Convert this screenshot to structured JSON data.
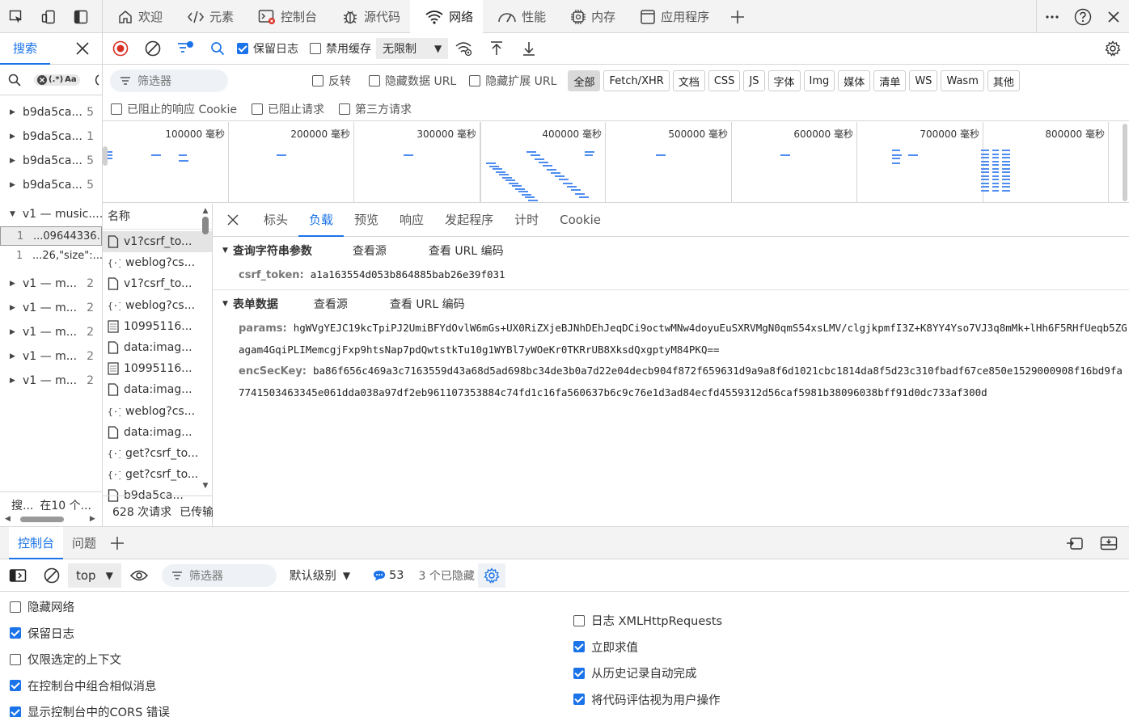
{
  "topbar": {
    "tabs": [
      {
        "label": "欢迎",
        "icon": "home-icon"
      },
      {
        "label": "元素",
        "icon": "code-icon"
      },
      {
        "label": "控制台",
        "icon": "console-icon"
      },
      {
        "label": "源代码",
        "icon": "bug-icon"
      },
      {
        "label": "网络",
        "icon": "wifi-icon"
      },
      {
        "label": "性能",
        "icon": "gauge-icon"
      },
      {
        "label": "内存",
        "icon": "chip-icon"
      },
      {
        "label": "应用程序",
        "icon": "app-icon"
      }
    ]
  },
  "search": {
    "title": "搜索",
    "regex_label": "(.*)",
    "case_label": "Aa",
    "results": [
      {
        "name": "b9da5ca...",
        "count": "5"
      },
      {
        "name": "b9da5ca...",
        "count": "1"
      },
      {
        "name": "b9da5ca...",
        "count": "5"
      },
      {
        "name": "b9da5ca...",
        "count": "5"
      }
    ],
    "expanded": {
      "name": "v1 — music....",
      "lines": [
        {
          "ln": "1",
          "text": "...09644336..."
        },
        {
          "ln": "1",
          "text": "...26,\"size\":..."
        }
      ]
    },
    "more": [
      {
        "name": "v1 — m...",
        "count": "2"
      },
      {
        "name": "v1 — m...",
        "count": "2"
      },
      {
        "name": "v1 — m...",
        "count": "2"
      },
      {
        "name": "v1 — m...",
        "count": "2"
      },
      {
        "name": "v1 — m...",
        "count": "2"
      }
    ],
    "footer": {
      "left": "搜...",
      "right": "在10 个..."
    }
  },
  "toolbar": {
    "preserve_log": "保留日志",
    "disable_cache": "禁用缓存",
    "throttle": "无限制"
  },
  "filter": {
    "placeholder": "筛选器",
    "invert": "反转",
    "hide_data_url": "隐藏数据 URL",
    "hide_ext_url": "隐藏扩展 URL",
    "types": [
      "全部",
      "Fetch/XHR",
      "文档",
      "CSS",
      "JS",
      "字体",
      "Img",
      "媒体",
      "清单",
      "WS",
      "Wasm",
      "其他"
    ],
    "blocked_cookies": "已阻止的响应 Cookie",
    "blocked_requests": "已阻止请求",
    "third_party": "第三方请求"
  },
  "overview": {
    "ticks": [
      "100000 毫秒",
      "200000 毫秒",
      "300000 毫秒",
      "400000 毫秒",
      "500000 毫秒",
      "600000 毫秒",
      "700000 毫秒",
      "800000 毫秒"
    ]
  },
  "requests": {
    "header": "名称",
    "rows": [
      {
        "name": "v1?csrf_to...",
        "icon": "doc-icon"
      },
      {
        "name": "weblog?cs...",
        "icon": "xhr-icon"
      },
      {
        "name": "v1?csrf_to...",
        "icon": "doc-icon"
      },
      {
        "name": "weblog?cs...",
        "icon": "xhr-icon"
      },
      {
        "name": "10995116...",
        "icon": "img-icon"
      },
      {
        "name": "data:imag...",
        "icon": "doc-icon"
      },
      {
        "name": "10995116...",
        "icon": "img-icon"
      },
      {
        "name": "data:imag...",
        "icon": "doc-icon"
      },
      {
        "name": "weblog?cs...",
        "icon": "xhr-icon"
      },
      {
        "name": "data:imag...",
        "icon": "doc-icon"
      },
      {
        "name": "get?csrf_to...",
        "icon": "xhr-icon"
      },
      {
        "name": "get?csrf_to...",
        "icon": "xhr-icon"
      },
      {
        "name": "b9da5ca...",
        "icon": "doc-icon"
      }
    ],
    "footer_count": "628 次请求",
    "footer_transfer": "已传输"
  },
  "detail": {
    "tabs": [
      "标头",
      "负载",
      "预览",
      "响应",
      "发起程序",
      "计时",
      "Cookie"
    ],
    "query": {
      "title": "查询字符串参数",
      "view_source": "查看源",
      "view_url": "查看 URL 编码",
      "key": "csrf_token:",
      "value": "a1a163554d053b864885bab26e39f031"
    },
    "form": {
      "title": "表单数据",
      "view_source": "查看源",
      "view_url": "查看 URL 编码",
      "params_key": "params:",
      "params_value": "hgWVgYEJC19kcTpiPJ2UmiBFYdOvlW6mGs+UX0RiZXjeBJNhDEhJeqDCi9octwMNw4doyuEuSXRVMgN0qmS54xsLMV/clgjkpmfI3Z+K8YY4Yso7VJ3q8mMk+lHh6F5RHfUeqb5ZGagam4GqiPLIMemcgjFxp9htsNap7pdQwtstkTu10g1WYBl7yWOeKr0TKRrUB8XksdQxgptyM84PKQ==",
      "enc_key": "encSecKey:",
      "enc_value": "ba86f656c469a3c7163559d43a68d5ad698bc34de3b0a7d22e04decb904f872f659631d9a9a8f6d1021cbc1814da8f5d23c310fbadf67ce850e1529000908f16bd9fa7741503463345e061dda038a97df2eb961107353884c74fd1c16fa560637b6c9c76e1d3ad84ecfd4559312d56caf5981b38096038bff91d0dc733af300d"
    }
  },
  "drawer": {
    "tabs": [
      "控制台",
      "问题"
    ],
    "context": "top",
    "filter_placeholder": "筛选器",
    "level": "默认级别",
    "messages": "53",
    "hidden": "3 个已隐藏",
    "options_left": [
      {
        "label": "隐藏网络",
        "checked": false
      },
      {
        "label": "保留日志",
        "checked": true
      },
      {
        "label": "仅限选定的上下文",
        "checked": false
      },
      {
        "label": "在控制台中组合相似消息",
        "checked": true
      },
      {
        "label": "显示控制台中的CORS 错误",
        "checked": true
      }
    ],
    "options_right": [
      {
        "label": "日志 XMLHttpRequests",
        "checked": false
      },
      {
        "label": "立即求值",
        "checked": true
      },
      {
        "label": "从历史记录自动完成",
        "checked": true
      },
      {
        "label": "将代码评估视为用户操作",
        "checked": true
      }
    ]
  },
  "colors": {
    "accent": "#1a73e8",
    "record": "#d93025",
    "bar": "#4e8cf0"
  }
}
